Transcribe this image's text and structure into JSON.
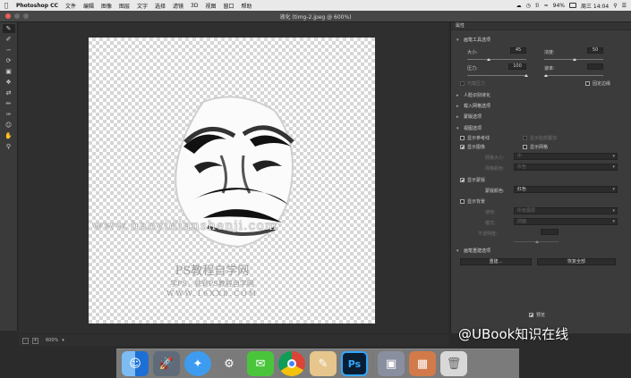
{
  "menubar": {
    "app": "Photoshop CC",
    "items": [
      "文件",
      "编辑",
      "图像",
      "图层",
      "文字",
      "选择",
      "滤镜",
      "3D",
      "视图",
      "窗口",
      "帮助"
    ],
    "battery": "94%",
    "clock": "周三 14:04"
  },
  "dialog": {
    "title": "液化 (timg-2.jpeg @ 600%)"
  },
  "canvas": {
    "watermark_url": "www.haoyidianshenji.com",
    "logo_title": "PS教程自学网",
    "logo_slogan": "学PS，就到PS教程自学网",
    "logo_url": "WWW.16XX8.COM"
  },
  "status": {
    "zoom": "600%"
  },
  "panel": {
    "header": "属性",
    "brush_section": "画笔工具选项",
    "size_label": "大小:",
    "size_value": "45",
    "density_label": "浓度:",
    "density_value": "50",
    "pressure_label": "压力:",
    "pressure_value": "100",
    "rate_label": "速率:",
    "stylus_label": "光笔压力",
    "pin_label": "固定边缘",
    "face_section": "人脸识别液化",
    "load_section": "载入网格选项",
    "mask_section": "蒙版选项",
    "view_section": "视图选项",
    "show_guides": "显示参考线",
    "show_face": "显示脸部叠加",
    "show_image": "显示图像",
    "show_mesh": "显示网格",
    "mesh_size_label": "网格大小:",
    "mesh_size_value": "中",
    "mesh_color_label": "网格颜色:",
    "mesh_color_value": "灰色",
    "show_mask": "显示蒙版",
    "mask_color_label": "蒙版颜色:",
    "mask_color_value": "红色",
    "show_backdrop": "显示背景",
    "use_label": "使用:",
    "use_value": "所有图层",
    "mode_label": "模式:",
    "mode_value": "前面",
    "opacity_label": "不透明度:",
    "rebuild_section": "画笔重建选项",
    "rebuild_button": "重建...",
    "restore_button": "恢复全部",
    "preview_label": "预览",
    "brand_overlay": "@UBook知识在线"
  },
  "dock": {
    "icons": [
      "finder-icon",
      "launchpad-icon",
      "safari-icon",
      "system-preferences-icon",
      "wechat-icon",
      "chrome-icon",
      "preview-icon",
      "photoshop-icon",
      "photos-icon",
      "gallery-icon",
      "trash-icon"
    ],
    "ps_label": "Ps"
  }
}
